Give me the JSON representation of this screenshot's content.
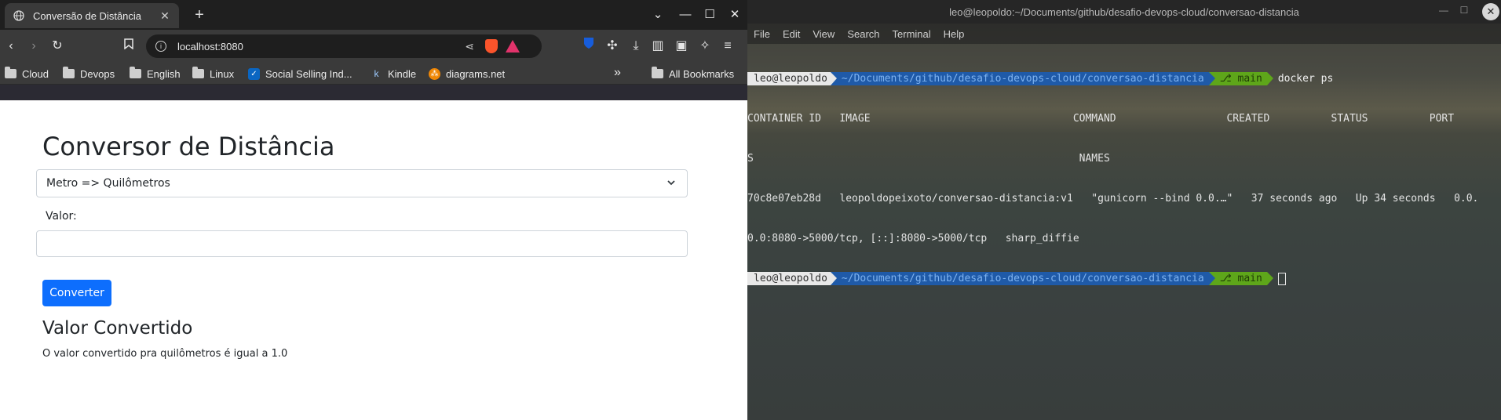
{
  "browser": {
    "tab": {
      "title": "Conversão de Distância"
    },
    "url": "localhost:8080",
    "bookmarks": [
      {
        "label": "Cloud",
        "icon": "folder-icon"
      },
      {
        "label": "Devops",
        "icon": "folder-icon"
      },
      {
        "label": "English",
        "icon": "folder-icon"
      },
      {
        "label": "Linux",
        "icon": "folder-icon"
      },
      {
        "label": "Social Selling Ind...",
        "icon": "linkedin-icon"
      },
      {
        "label": "Kindle",
        "icon": "kindle-icon"
      },
      {
        "label": "diagrams.net",
        "icon": "diagrams-icon"
      }
    ],
    "all_bookmarks": "All Bookmarks",
    "more": "»"
  },
  "page": {
    "title": "Conversor de Distância",
    "select_value": "Metro => Quilômetros",
    "value_label": "Valor:",
    "value_input": "",
    "convert_button": "Converter",
    "result_title": "Valor Convertido",
    "result_text": "O valor convertido pra quilômetros é igual a 1.0"
  },
  "terminal": {
    "title": "leo@leopoldo:~/Documents/github/desafio-devops-cloud/conversao-distancia",
    "menu": [
      "File",
      "Edit",
      "View",
      "Search",
      "Terminal",
      "Help"
    ],
    "prompt_user": "leo@leopoldo",
    "prompt_path": "~/Documents/github/desafio-devops-cloud/conversao-distancia",
    "prompt_branch": "main",
    "command": "docker ps",
    "output": [
      "CONTAINER ID   IMAGE                                 COMMAND                  CREATED          STATUS          PORT",
      "S                                                     NAMES",
      "70c8e07eb28d   leopoldopeixoto/conversao-distancia:v1   \"gunicorn --bind 0.0.…\"   37 seconds ago   Up 34 seconds   0.0.",
      "0.0:8080->5000/tcp, [::]:8080->5000/tcp   sharp_diffie"
    ]
  },
  "colors": {
    "primary_button": "#0d6efd",
    "prompt_path_bg": "#1f5aa8",
    "prompt_git_bg": "#5ea61a"
  }
}
